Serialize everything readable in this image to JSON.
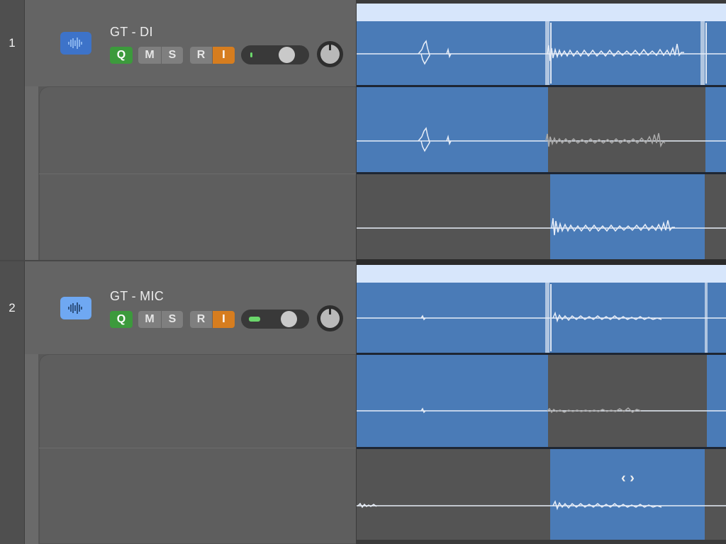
{
  "tracks": [
    {
      "number": "1",
      "name": "GT - DI",
      "icon": "waveform-icon",
      "icon_color": "#3d73c9",
      "buttons": {
        "q": "Q",
        "m": "M",
        "s": "S",
        "r": "R",
        "i": "I"
      }
    },
    {
      "number": "2",
      "name": "GT - MIC",
      "icon": "waveform-icon",
      "icon_color": "#6fa8f2",
      "buttons": {
        "q": "Q",
        "m": "M",
        "s": "S",
        "r": "R",
        "i": "I"
      }
    }
  ],
  "colors": {
    "region_blue": "#4a7bb7",
    "take_gray": "#545454",
    "record_orange": "#d67d1f",
    "quick_green": "#3c9a3c"
  },
  "cursor": {
    "glyph": "‹ ›",
    "name": "resize-cursor-icon"
  }
}
